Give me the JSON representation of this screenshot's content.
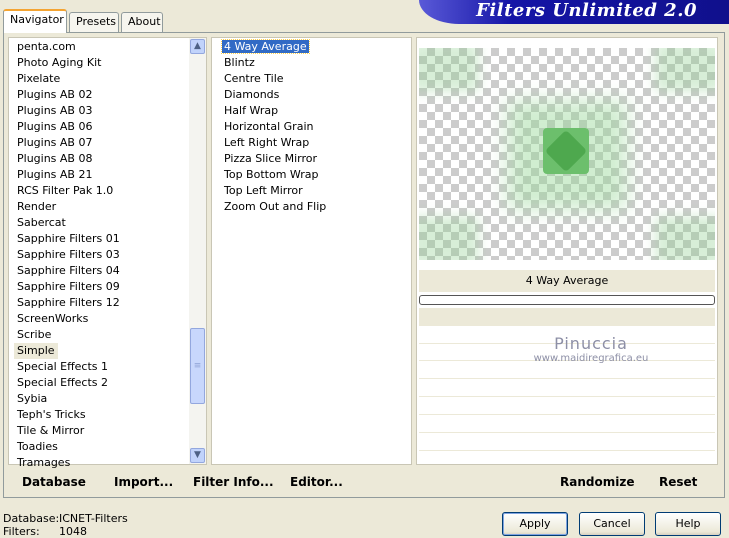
{
  "tabs": [
    "Navigator",
    "Presets",
    "About"
  ],
  "banner_title": "Filters Unlimited 2.0",
  "categories": [
    "penta.com",
    "Photo Aging Kit",
    "Pixelate",
    "Plugins AB 02",
    "Plugins AB 03",
    "Plugins AB 06",
    "Plugins AB 07",
    "Plugins AB 08",
    "Plugins AB 21",
    "RCS Filter Pak 1.0",
    "Render",
    "Sabercat",
    "Sapphire Filters 01",
    "Sapphire Filters 03",
    "Sapphire Filters 04",
    "Sapphire Filters 09",
    "Sapphire Filters 12",
    "ScreenWorks",
    "Scribe",
    "Simple",
    "Special Effects 1",
    "Special Effects 2",
    "Sybia",
    "Teph's Tricks",
    "Tile & Mirror",
    "Toadies",
    "Tramages"
  ],
  "selected_category": "Simple",
  "filters": [
    "4 Way Average",
    "Blintz",
    "Centre Tile",
    "Diamonds",
    "Half Wrap",
    "Horizontal Grain",
    "Left Right Wrap",
    "Pizza Slice Mirror",
    "Top Bottom Wrap",
    "Top Left Mirror",
    "Zoom Out and Flip"
  ],
  "selected_filter": "4 Way Average",
  "preview": {
    "filter_name": "4 Way Average",
    "watermark_line1": "Pinuccia",
    "watermark_line2": "www.maidiregrafica.eu",
    "accent_color": "#5cb85c"
  },
  "toolbar": {
    "database": "Database",
    "import": "Import...",
    "filter_info": "Filter Info...",
    "editor": "Editor...",
    "randomize": "Randomize",
    "reset": "Reset"
  },
  "footer": {
    "database_label": "Database:",
    "database_value": "ICNET-Filters",
    "filters_label": "Filters:",
    "filters_value": "1048",
    "apply": "Apply",
    "cancel": "Cancel",
    "help": "Help"
  }
}
